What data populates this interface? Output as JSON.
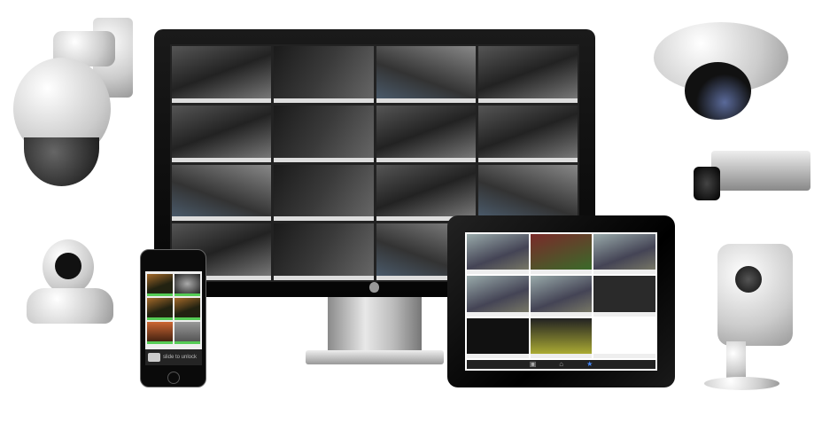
{
  "monitor": {
    "feeds": 16,
    "logo": "apple-logo"
  },
  "ipad": {
    "tab_icons": [
      "camera-icon",
      "home-icon",
      "star-icon"
    ]
  },
  "iphone": {
    "unlock_text": "slide to unlock"
  },
  "cameras": [
    "ptz-dome-camera",
    "robot-ip-camera",
    "ceiling-dome-camera",
    "bullet-camera",
    "cube-camera"
  ]
}
